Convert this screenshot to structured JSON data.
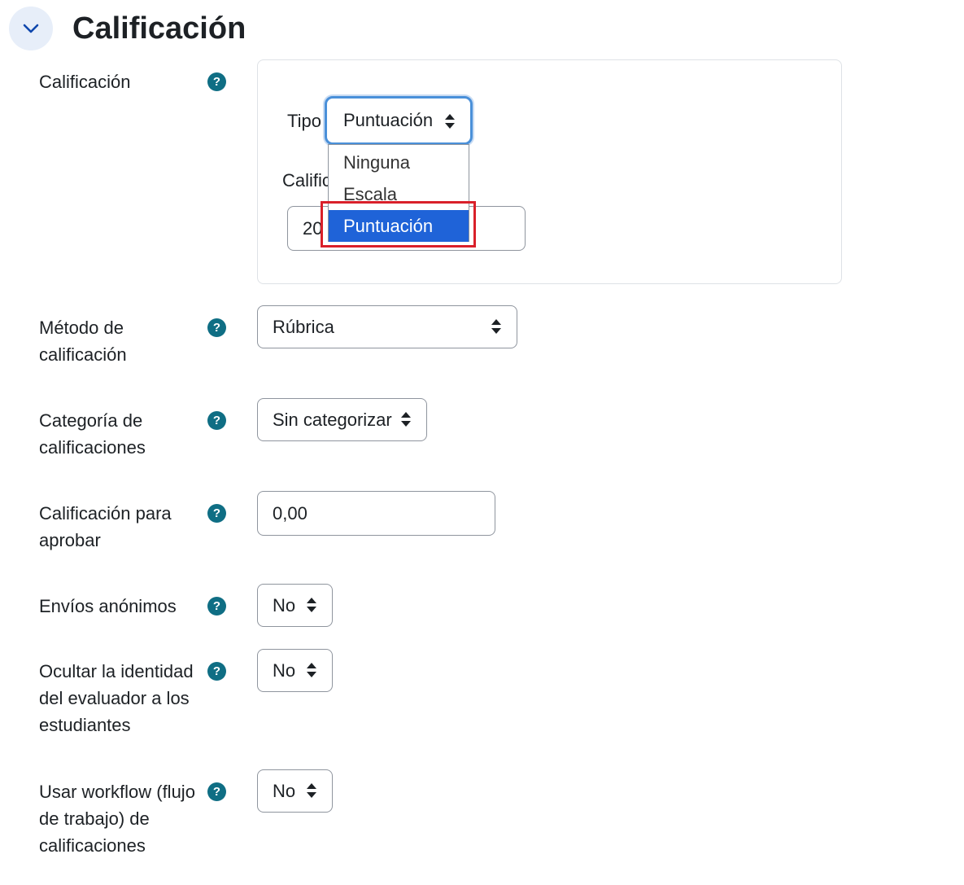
{
  "section": {
    "title": "Calificación"
  },
  "grade": {
    "label": "Calificación",
    "type_label": "Tipo",
    "type_value": "Puntuación",
    "type_options": [
      "Ninguna",
      "Escala",
      "Puntuación"
    ],
    "max_label": "Calific",
    "max_value": "20"
  },
  "grading_method": {
    "label": "Método de calificación",
    "value": "Rúbrica"
  },
  "grade_category": {
    "label": "Categoría de calificaciones",
    "value": "Sin categorizar"
  },
  "pass_grade": {
    "label": "Calificación para aprobar",
    "value": "0,00"
  },
  "anonymous": {
    "label": "Envíos anónimos",
    "value": "No"
  },
  "hide_grader": {
    "label": "Ocultar la identidad del evaluador a los estudiantes",
    "value": "No"
  },
  "workflow": {
    "label": "Usar workflow (flujo de trabajo) de calificaciones",
    "value": "No"
  },
  "help_symbol": "?",
  "colors": {
    "accent": "#0f6e84",
    "selected_option": "#1f63d8",
    "highlight": "#d9202a"
  }
}
